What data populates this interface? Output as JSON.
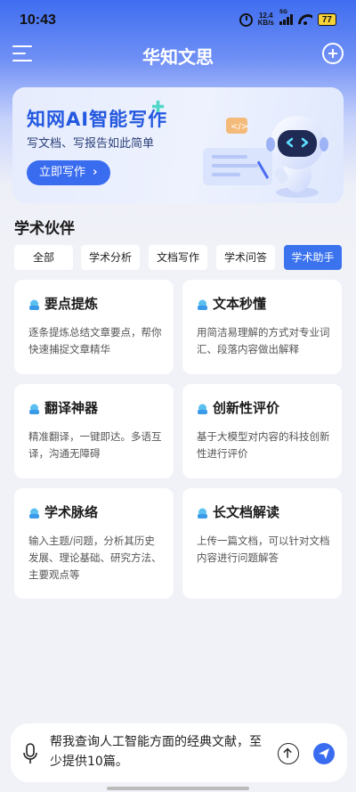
{
  "status_bar": {
    "time": "10:43",
    "net_speed_value": "12.4",
    "net_speed_unit": "KB/s",
    "signal_label": "5G",
    "battery": "77"
  },
  "app": {
    "title": "华知文思",
    "menu_icon": "menu-icon",
    "add_icon": "plus-circle-icon"
  },
  "banner": {
    "title": "知网AI智能写作",
    "subtitle": "写文档、写报告如此简单",
    "button_label": "立即写作",
    "button_arrow": "›"
  },
  "section": {
    "title": "学术伙伴"
  },
  "tabs": [
    {
      "label": "全部",
      "active": false
    },
    {
      "label": "学术分析",
      "active": false
    },
    {
      "label": "文档写作",
      "active": false
    },
    {
      "label": "学术问答",
      "active": false
    },
    {
      "label": "学术助手",
      "active": true
    }
  ],
  "cards": [
    {
      "title": "要点提炼",
      "desc": "逐条提炼总结文章要点，帮你快速捕捉文章精华"
    },
    {
      "title": "文本秒懂",
      "desc": "用简洁易理解的方式对专业词汇、段落内容做出解释"
    },
    {
      "title": "翻译神器",
      "desc": "精准翻译，一键即达。多语互译，沟通无障碍"
    },
    {
      "title": "创新性评价",
      "desc": "基于大模型对内容的科技创新性进行评价"
    },
    {
      "title": "学术脉络",
      "desc": "输入主题/问题，分析其历史发展、理论基础、研究方法、主要观点等"
    },
    {
      "title": "长文档解读",
      "desc": "上传一篇文档，可以针对文档内容进行问题解答"
    }
  ],
  "input": {
    "value": "帮我查询人工智能方面的经典文献，至少提供10篇。"
  },
  "colors": {
    "accent": "#3a6cf0",
    "active_tab": "#3b73ee",
    "background": "#f1f2f7"
  }
}
